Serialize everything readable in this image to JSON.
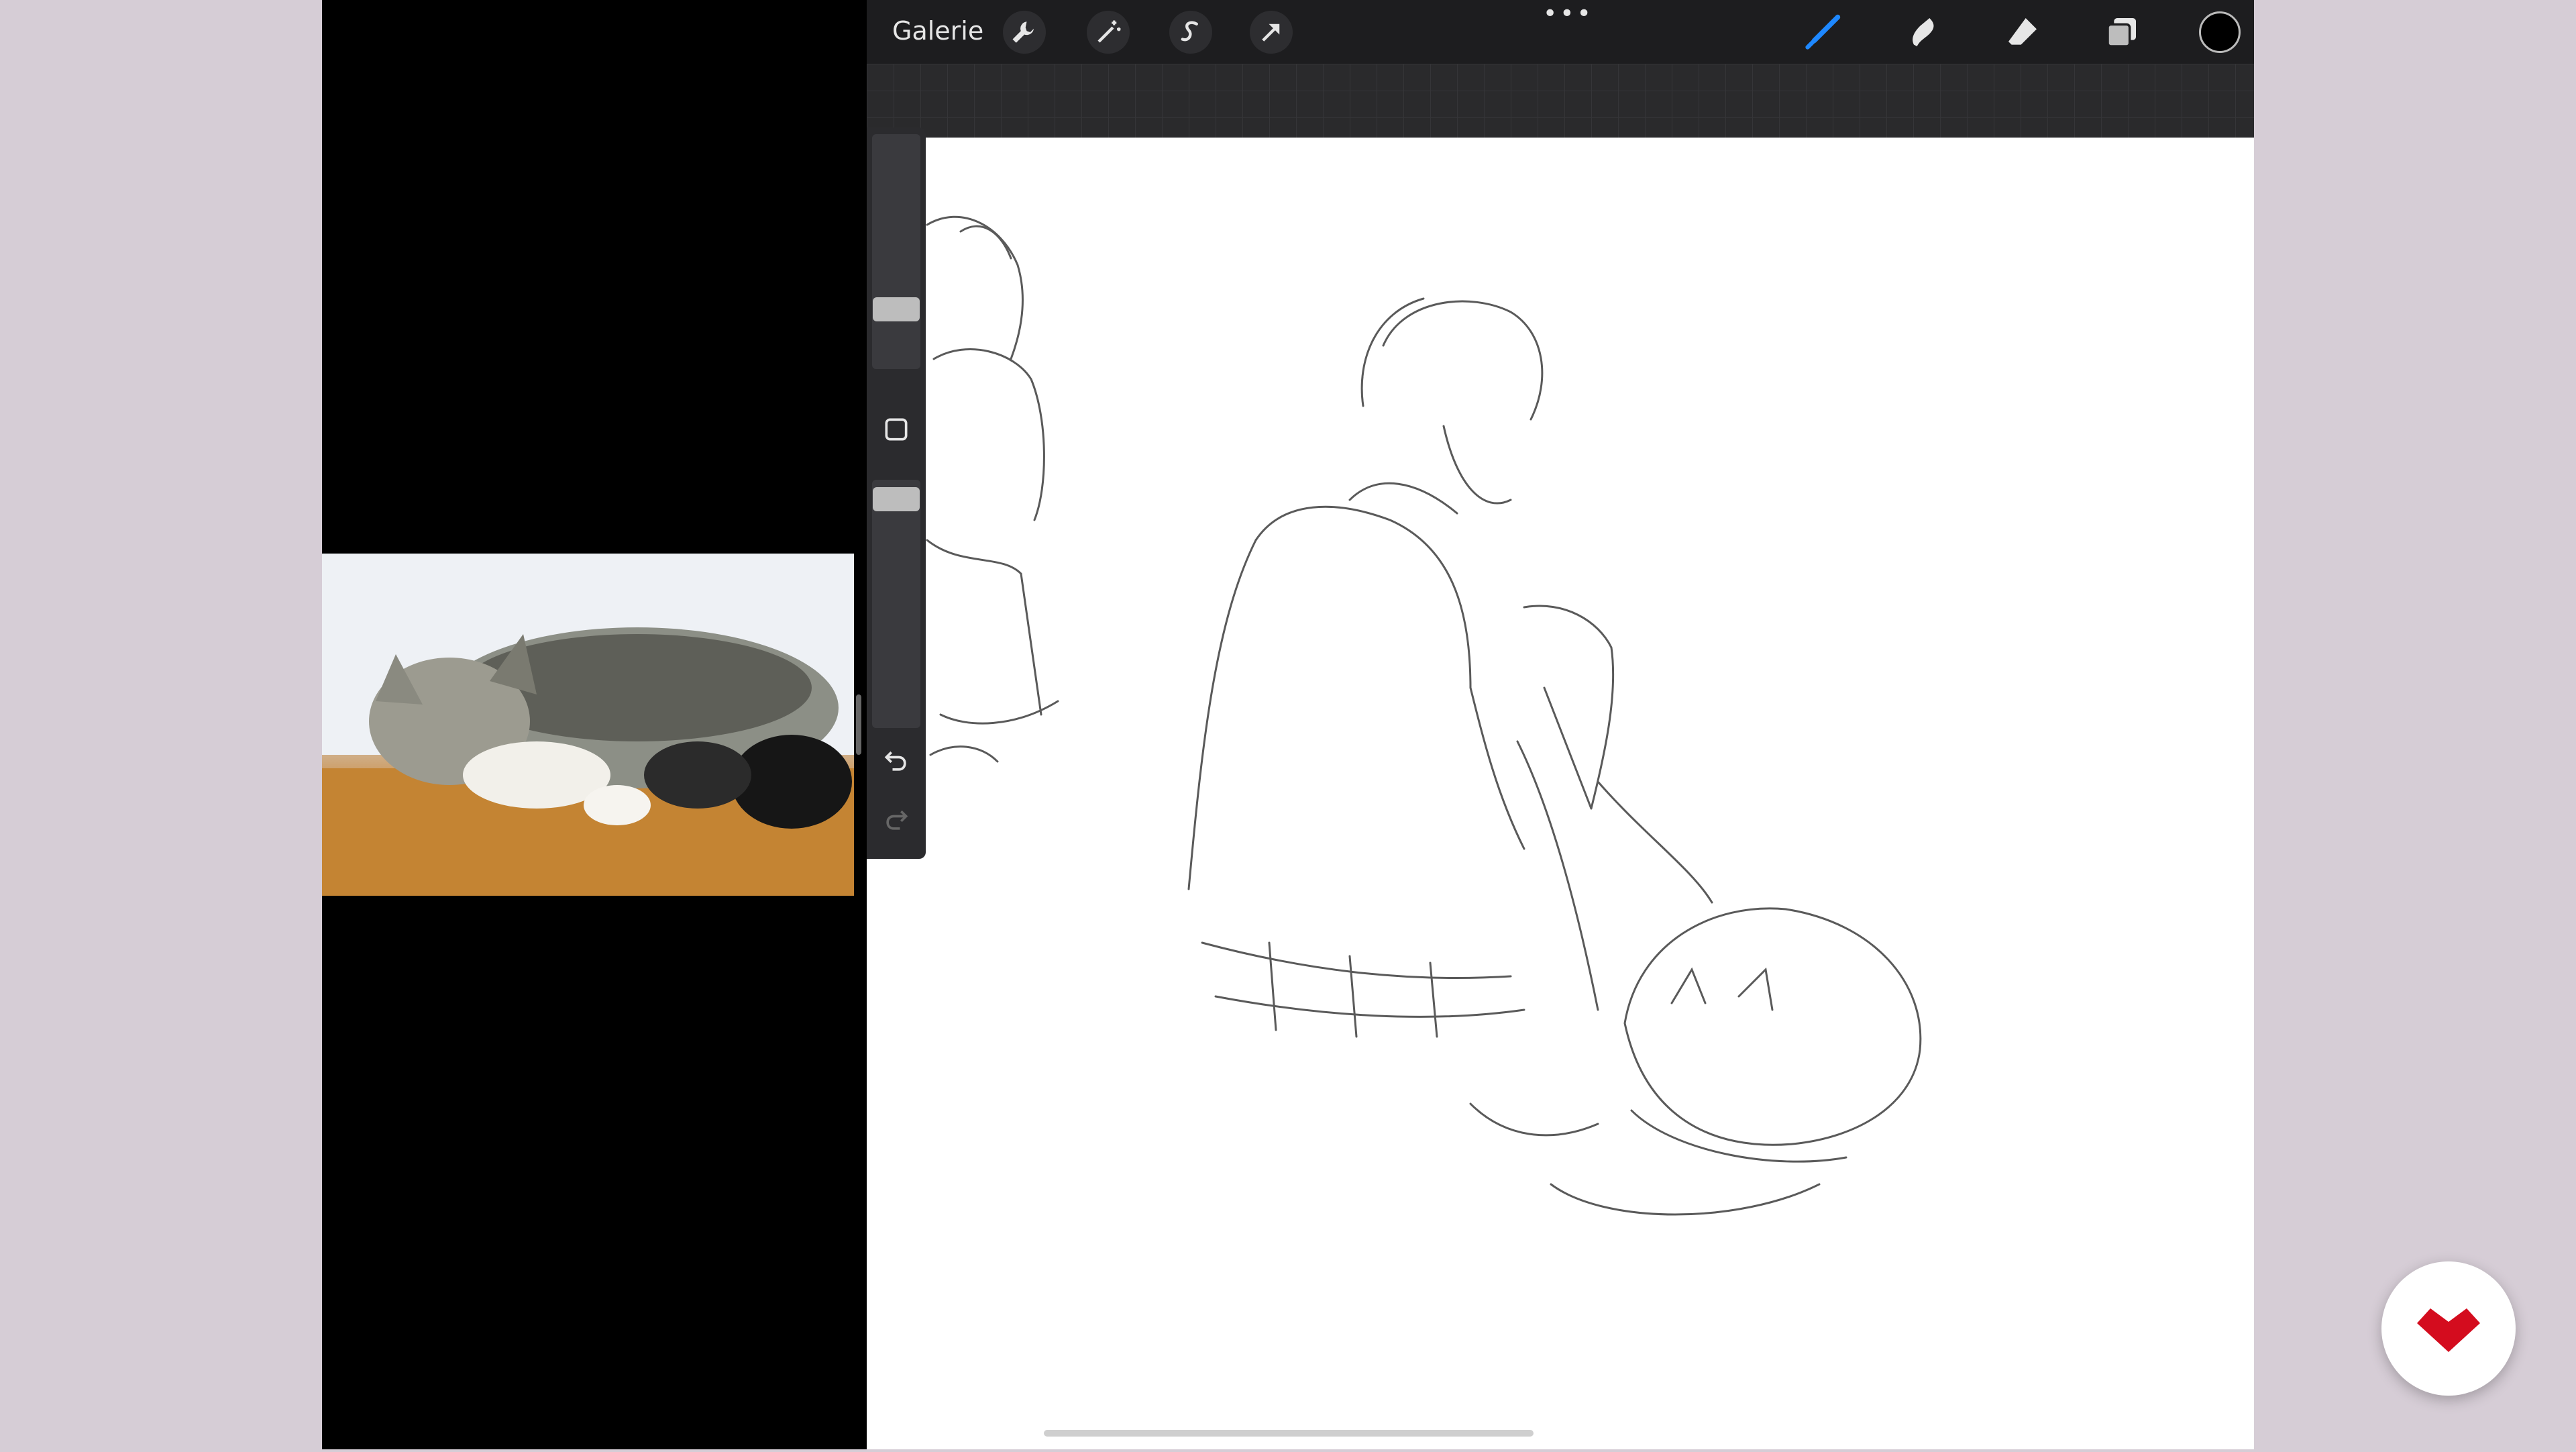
{
  "topbar": {
    "gallery_label": "Galerie",
    "more_menu_label": "•••"
  },
  "colors": {
    "accent_brush": "#1e88ff",
    "current_color": "#000000",
    "logo_red": "#d40c1e"
  },
  "icons": [
    "wrench-icon",
    "magic-wand-icon",
    "selection-s-icon",
    "transform-arrow-icon",
    "brush-icon",
    "smudge-icon",
    "eraser-icon",
    "layers-icon",
    "color-swatch-icon",
    "undo-icon",
    "redo-icon",
    "square-modify-icon"
  ],
  "sidebar": {
    "brush_size_level": 0.4,
    "opacity_level": 0.85
  }
}
